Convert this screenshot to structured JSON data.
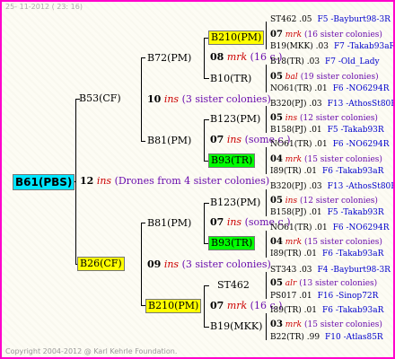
{
  "header": {
    "date": "25- 11-2012 ( 23: 16)"
  },
  "footer": {
    "copyright": "Copyright 2004-2012 @ Karl Kehrle Foundation."
  },
  "root": {
    "label": "B61(PBS)",
    "gen": "12",
    "ins": "ins",
    "note": "(Drones from 4 sister colonies)"
  },
  "queens": {
    "b53": "B53(CF)",
    "b26": "B26(CF)",
    "b72": "B72(PM)",
    "b81a": "B81(PM)",
    "b81b": "B81(PM)",
    "b210a": "B210(PM)",
    "b210b": "B210(PM)",
    "b10": "B10(TR)",
    "b123a": "B123(PM)",
    "b123b": "B123(PM)",
    "b93a": "B93(TR)",
    "b93b": "B93(TR)",
    "st462": "ST462",
    "b19mkk": "B19(MKK)"
  },
  "matings": {
    "m10": {
      "gen": "10",
      "ins": "ins",
      "note": "(3 sister colonies)"
    },
    "m09": {
      "gen": "09",
      "ins": "ins",
      "note": "(3 sister colonies)"
    },
    "m08": {
      "gen": "08",
      "ins": "mrk",
      "note": "(16 c.)"
    },
    "m07a": {
      "gen": "07",
      "ins": "ins",
      "note": "(some c.)"
    },
    "m07b": {
      "gen": "07",
      "ins": "ins",
      "note": "(some c.)"
    },
    "m07c": {
      "gen": "07",
      "ins": "mrk",
      "note": "(16 c.)"
    }
  },
  "leaves": [
    {
      "a": "ST462 .05",
      "b": "F5 -Bayburt98-3R"
    },
    {
      "gen": "07",
      "ins": "mrk",
      "note": "(16 sister colonies)"
    },
    {
      "a": "B19(MKK) .03",
      "b": "F7 -Takab93aR"
    },
    {
      "a": "B18(TR) .03",
      "b": "F7 -Old_Lady"
    },
    {
      "gen": "05",
      "ins": "bal",
      "note": "(19 sister colonies)"
    },
    {
      "a": "NO61(TR) .01",
      "b": "F6 -NO6294R"
    },
    {
      "a": "B320(PJ) .03",
      "b": "F13 -AthosSt80R"
    },
    {
      "gen": "05",
      "ins": "ins",
      "note": "(12 sister colonies)"
    },
    {
      "a": "B158(PJ) .01",
      "b": "F5 -Takab93R"
    },
    {
      "a": "NO61(TR) .01",
      "b": "F6 -NO6294R"
    },
    {
      "gen": "04",
      "ins": "mrk",
      "note": "(15 sister colonies)"
    },
    {
      "a": "I89(TR) .01",
      "b": "F6 -Takab93aR"
    },
    {
      "a": "B320(PJ) .03",
      "b": "F13 -AthosSt80R"
    },
    {
      "gen": "05",
      "ins": "ins",
      "note": "(12 sister colonies)"
    },
    {
      "a": "B158(PJ) .01",
      "b": "F5 -Takab93R"
    },
    {
      "a": "NO61(TR) .01",
      "b": "F6 -NO6294R"
    },
    {
      "gen": "04",
      "ins": "mrk",
      "note": "(15 sister colonies)"
    },
    {
      "a": "I89(TR) .01",
      "b": "F6 -Takab93aR"
    },
    {
      "a": "ST343 .03",
      "b": "F4 -Bayburt98-3R"
    },
    {
      "gen": "05",
      "ins": "alr",
      "note": "(13 sister colonies)"
    },
    {
      "a": "PS017 .01",
      "b": "F16 -Sinop72R"
    },
    {
      "a": "I89(TR) .01",
      "b": "F6 -Takab93aR"
    },
    {
      "gen": "03",
      "ins": "mrk",
      "note": "(15 sister colonies)"
    },
    {
      "a": "B22(TR) .99",
      "b": "F10 -Atlas85R"
    }
  ]
}
